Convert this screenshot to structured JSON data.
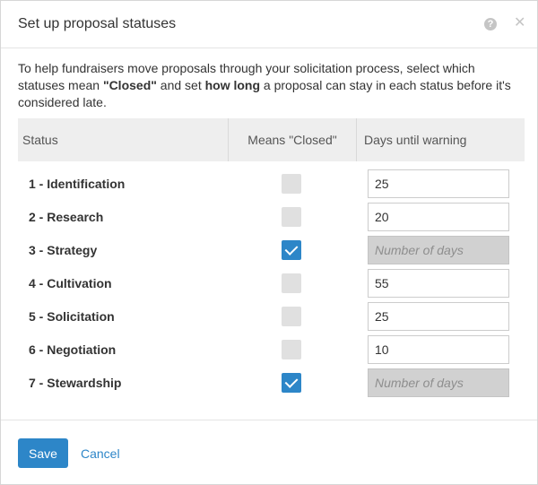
{
  "dialog": {
    "title": "Set up proposal statuses",
    "intro": {
      "part1": "To help fundraisers move proposals through your solicitation process, select which statuses mean ",
      "bold1": "\"Closed\"",
      "part2": " and set ",
      "bold2": "how long",
      "part3": " a proposal can stay in each status before it's considered late."
    }
  },
  "table": {
    "headers": {
      "status": "Status",
      "closed": "Means \"Closed\"",
      "days": "Days until warning"
    },
    "days_placeholder": "Number of days",
    "rows": [
      {
        "label": "1 - Identification",
        "closed": false,
        "days": "25"
      },
      {
        "label": "2 - Research",
        "closed": false,
        "days": "20"
      },
      {
        "label": "3 - Strategy",
        "closed": true,
        "days": ""
      },
      {
        "label": "4 - Cultivation",
        "closed": false,
        "days": "55"
      },
      {
        "label": "5 - Solicitation",
        "closed": false,
        "days": "25"
      },
      {
        "label": "6 - Negotiation",
        "closed": false,
        "days": "10"
      },
      {
        "label": "7 - Stewardship",
        "closed": true,
        "days": ""
      }
    ]
  },
  "footer": {
    "save_label": "Save",
    "cancel_label": "Cancel"
  },
  "icons": {
    "help": "help-circle-icon",
    "close": "close-icon"
  },
  "colors": {
    "accent": "#2d86c8",
    "unchecked": "#e0e0e0",
    "disabled_input": "#d1d1d1"
  }
}
